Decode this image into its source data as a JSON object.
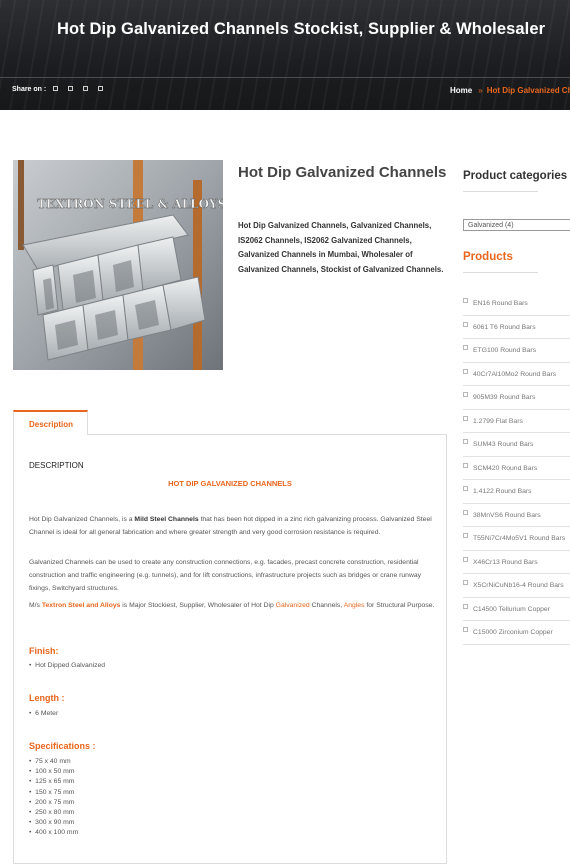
{
  "header": {
    "title": "Hot Dip Galvanized Channels Stockist, Supplier & Wholesaler",
    "share_label": "Share on :",
    "breadcrumb": {
      "home": "Home",
      "separator": "»",
      "current": "Hot Dip Galvanized Channels"
    }
  },
  "product": {
    "title": "Hot Dip Galvanized Channels",
    "image_watermark": "TEXTRON STEEL & ALLOYS",
    "summary": "Hot Dip Galvanized Channels, Galvanized Channels, IS2062 Channels, IS2062 Galvanized Channels, Galvanized Channels in Mumbai, Wholesaler of Galvanized Channels, Stockist of Galvanized Channels."
  },
  "sidebar": {
    "categories_heading": "Product categories",
    "category_selected": "Galvanized  (4)",
    "products_heading": "Products",
    "products": [
      "EN16 Round Bars",
      "6061 T6 Round Bars",
      "ETG100 Round Bars",
      "40Cr7Al10Mo2 Round Bars",
      "905M39 Round Bars",
      "1.2799 Flat Bars",
      "SUM43 Round Bars",
      "SCM420 Round Bars",
      "1.4122 Round Bars",
      "38MnVS6 Round Bars",
      "T55Ni7Cr4Mo5V1 Round Bars",
      "X46Cr13 Round Bars",
      "X5CrNiCuNb16-4 Round Bars",
      "C14500 Tellurium Copper",
      "C15000 Zirconium Copper"
    ]
  },
  "tabs": {
    "description": "Description"
  },
  "description": {
    "heading": "DESCRIPTION",
    "subheading": "HOT DIP GALVANIZED CHANNELS",
    "p1_a": "Hot Dip Galvanized Channels, is a ",
    "p1_b": "Mild Steel Channels",
    "p1_c": " that has been hot dipped in a zinc rich galvanizing process. Galvanized Steel Channel is ideal for all general fabrication and where greater strength and very good corrosion resistance is required.",
    "p2": "Galvanized Channels can be used to create any construction connections, e.g. facades, precast concrete construction, residential construction and traffic engineering (e.g. tunnels), and for lift constructions, infrastructure projects such as bridges or crane runway fixings, Switchyard structures.",
    "p3_a": "M/s ",
    "p3_b": "Textron Steel and Alloys",
    "p3_c": " is Major Stockiest, Supplier, Wholesaler of Hot Dip ",
    "p3_d": "Galvanized",
    "p3_e": " Channels, ",
    "p3_f": "Angles",
    "p3_g": " for Structural Purpose.",
    "finish_heading": "Finish:",
    "finish_value": "Hot Dipped Galvanized",
    "length_heading": "Length :",
    "length_value": "6 Meter",
    "specs_heading": "Specifications :",
    "specs": [
      "75 x 40 mm",
      "100 x 50 mm",
      "125 x 65 mm",
      "150 x 75 mm",
      "200 x 75 mm",
      "250 x 80 mm",
      "300 x 90 mm",
      "400 x 100 mm"
    ]
  },
  "colors": {
    "accent": "#e8661d",
    "banner": "#1f2023"
  }
}
